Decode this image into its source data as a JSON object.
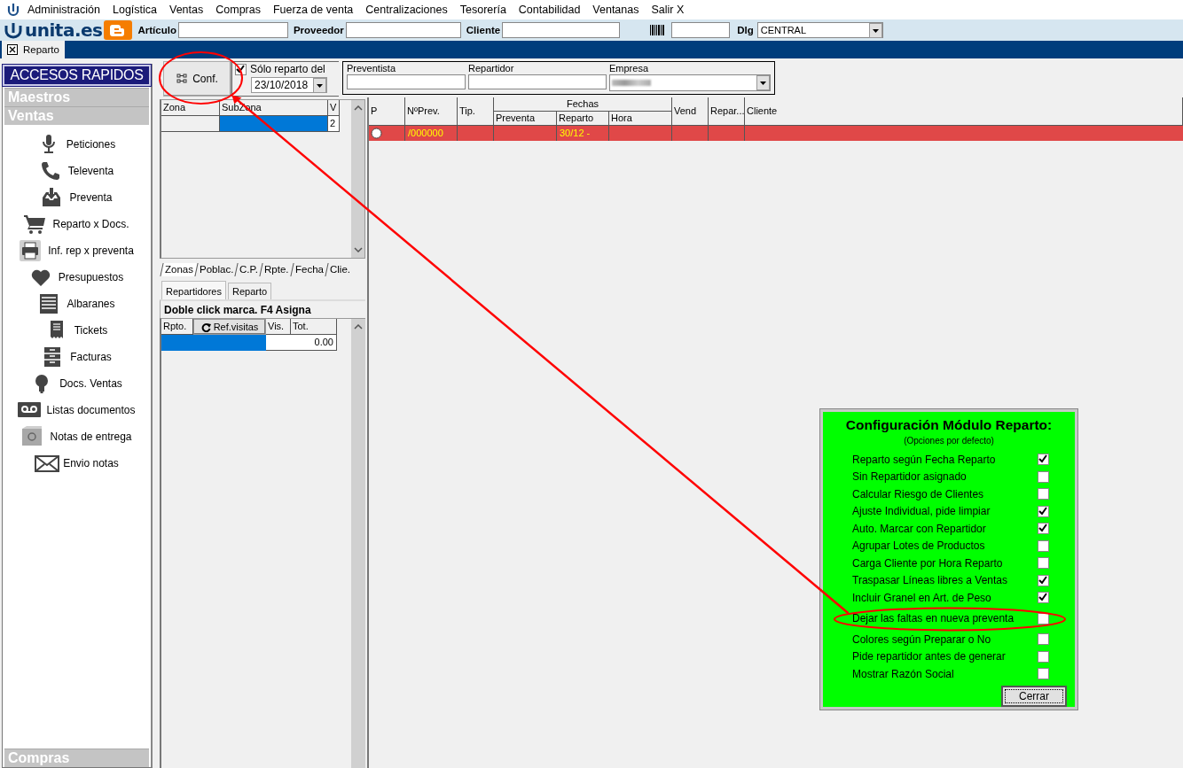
{
  "menu": [
    {
      "label": "Administración"
    },
    {
      "label": "Logística"
    },
    {
      "label": "Ventas"
    },
    {
      "label": "Compras"
    },
    {
      "label": "Fuerza de venta"
    },
    {
      "label": "Centralizaciones"
    },
    {
      "label": "Tesorería"
    },
    {
      "label": "Contabilidad"
    },
    {
      "label": "Ventanas"
    },
    {
      "label": "Salir X"
    }
  ],
  "toolbar": {
    "logo": "unita.es",
    "fields": [
      {
        "kind": "text",
        "label": "Artículo"
      },
      {
        "kind": "text",
        "label": "Proveedor"
      },
      {
        "kind": "text",
        "label": "Cliente"
      },
      {
        "kind": "barcode"
      },
      {
        "kind": "combo",
        "label": "Dlg",
        "value": "CENTRAL"
      }
    ]
  },
  "doc_tabs": [
    {
      "label": "Reparto",
      "selected": true
    }
  ],
  "sidebar": {
    "title": "ACCESOS RAPIDOS",
    "sections": [
      {
        "label": "Maestros"
      },
      {
        "label": "Ventas",
        "items": [
          {
            "label": "Peticiones"
          },
          {
            "label": "Televenta"
          },
          {
            "label": "Preventa"
          },
          {
            "label": "Reparto x Docs."
          },
          {
            "label": "Inf. rep x preventa"
          },
          {
            "label": "Presupuestos"
          },
          {
            "label": "Albaranes"
          },
          {
            "label": "Tickets"
          },
          {
            "label": "Facturas"
          },
          {
            "label": "Docs. Ventas"
          },
          {
            "label": "Listas documentos"
          },
          {
            "label": "Notas de entrega"
          },
          {
            "label": "Envio notas"
          }
        ]
      },
      {
        "label": "Compras"
      }
    ]
  },
  "conf_button": {
    "label": "Conf.",
    "highlighted": true
  },
  "date_filter": {
    "label": "Sólo reparto del",
    "checked": true,
    "value": "23/10/2018"
  },
  "filters": [
    {
      "kind": "text",
      "label": "Preventista"
    },
    {
      "kind": "text",
      "label": "Repartidor"
    },
    {
      "kind": "combo",
      "label": "Empresa",
      "blurred": true
    }
  ],
  "zone_grid": {
    "columns": [
      "Zona",
      "SubZona",
      "V"
    ],
    "rows": [
      {
        "selected": true,
        "v": "2"
      }
    ]
  },
  "zone_tabs": [
    {
      "label": "Zonas",
      "selected": true
    },
    {
      "label": "Poblac.",
      "selected": false
    },
    {
      "label": "C.P.",
      "selected": false
    },
    {
      "label": "Rpte.",
      "selected": false
    },
    {
      "label": "Fecha",
      "selected": false
    },
    {
      "label": "Clie.",
      "selected": false
    }
  ],
  "lower_tabs": [
    {
      "label": "Repartidores",
      "selected": true
    },
    {
      "label": "Reparto",
      "selected": false
    }
  ],
  "hint": "Doble click marca. F4 Asigna",
  "rep_grid": {
    "columns": [
      {
        "label": "Rpto."
      },
      {
        "label": "Ref.visitas",
        "kind": "button"
      },
      {
        "label": "Vis."
      },
      {
        "label": "Tot."
      }
    ],
    "rows": [
      {
        "selected": true,
        "total": "0.00"
      }
    ]
  },
  "main_grid": {
    "columns": [
      {
        "label": "P"
      },
      {
        "label": "NºPrev."
      },
      {
        "label": "Tip."
      },
      {
        "label": "Fechas",
        "children": [
          {
            "label": "Preventa"
          },
          {
            "label": "Reparto"
          },
          {
            "label": "Hora"
          }
        ]
      },
      {
        "label": "Vend"
      },
      {
        "label": "Repar..."
      },
      {
        "label": "Cliente"
      }
    ],
    "rows": [
      {
        "color": "#e04848",
        "marked": false,
        "number": "/000000",
        "reparto": "30/12 -"
      }
    ]
  },
  "config_dialog": {
    "title": "Configuración Módulo Reparto:",
    "subtitle": "(Opciones por defecto)",
    "options": [
      {
        "label": "Reparto según Fecha Reparto",
        "checked": true,
        "highlighted": false
      },
      {
        "label": "Sin Repartidor asignado",
        "checked": false,
        "highlighted": false
      },
      {
        "label": "Calcular Riesgo de Clientes",
        "checked": false,
        "highlighted": false
      },
      {
        "label": "Ajuste Individual, pide limpiar",
        "checked": true,
        "highlighted": false
      },
      {
        "label": "Auto. Marcar con Repartidor",
        "checked": true,
        "highlighted": false
      },
      {
        "label": "Agrupar Lotes de Productos",
        "checked": false,
        "highlighted": false
      },
      {
        "label": "Carga Cliente por Hora Reparto",
        "checked": false,
        "highlighted": false
      },
      {
        "label": "Traspasar Líneas libres a Ventas",
        "checked": true,
        "highlighted": false
      },
      {
        "label": "Incluir Granel en Art. de Peso",
        "checked": true,
        "highlighted": false
      },
      {
        "label": "Dejar las faltas en nueva preventa",
        "checked": false,
        "highlighted": true
      },
      {
        "label": "Colores según Preparar o No",
        "checked": false,
        "highlighted": false
      },
      {
        "label": "Pide repartidor antes de generar",
        "checked": false,
        "highlighted": false
      },
      {
        "label": "Mostrar Razón Social",
        "checked": false,
        "highlighted": false
      }
    ],
    "button": "Cerrar"
  }
}
